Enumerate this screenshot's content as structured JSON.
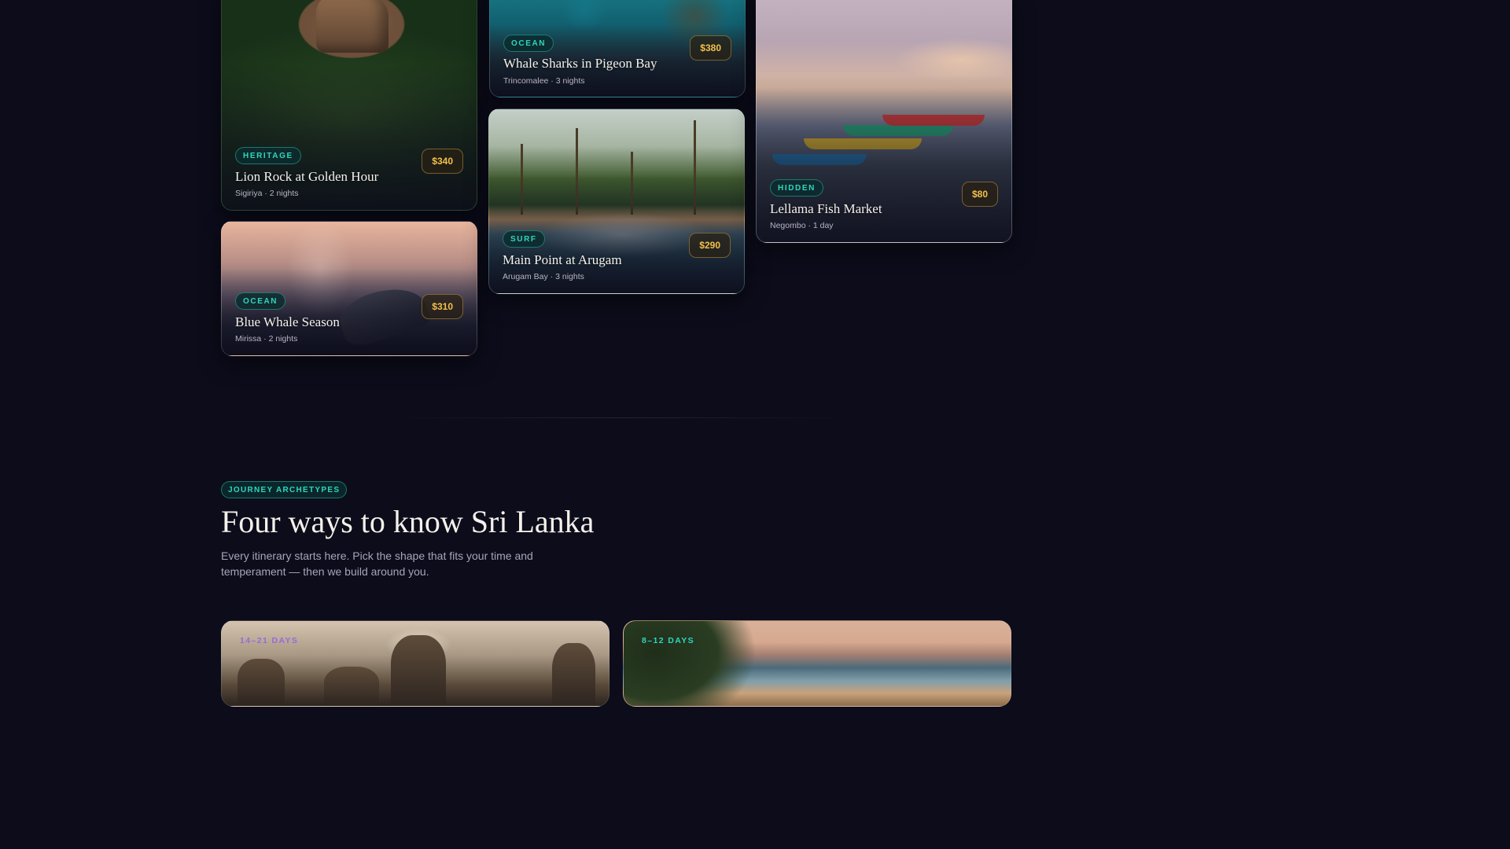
{
  "experiences": [
    {
      "id": "lion-rock",
      "tag": "HERITAGE",
      "title": "Lion Rock at Golden Hour",
      "meta": "Sigiriya · 2 nights",
      "price": "$340"
    },
    {
      "id": "blue-whale",
      "tag": "OCEAN",
      "title": "Blue Whale Season",
      "meta": "Mirissa · 2 nights",
      "price": "$310"
    },
    {
      "id": "whale-sharks",
      "tag": "OCEAN",
      "title": "Whale Sharks in Pigeon Bay",
      "meta": "Trincomalee · 3 nights",
      "price": "$380"
    },
    {
      "id": "main-point",
      "tag": "SURF",
      "title": "Main Point at Arugam",
      "meta": "Arugam Bay · 3 nights",
      "price": "$290"
    },
    {
      "id": "fish-market",
      "tag": "HIDDEN",
      "title": "Lellama Fish Market",
      "meta": "Negombo · 1 day",
      "price": "$80"
    }
  ],
  "journeys": {
    "badge": "JOURNEY ARCHETYPES",
    "title": "Four ways to know Sri Lanka",
    "description": "Every itinerary starts here. Pick the shape that fits your time and temperament — then we build around you.",
    "cards": [
      {
        "days": "14–21 DAYS",
        "accent": "#9a6ad6"
      },
      {
        "days": "8–12 DAYS",
        "accent": "#2fd6bd"
      }
    ]
  },
  "colors": {
    "background": "#0c0c1b",
    "teal_accent": "#2fd6bd",
    "price_gold": "#f2c04a"
  }
}
